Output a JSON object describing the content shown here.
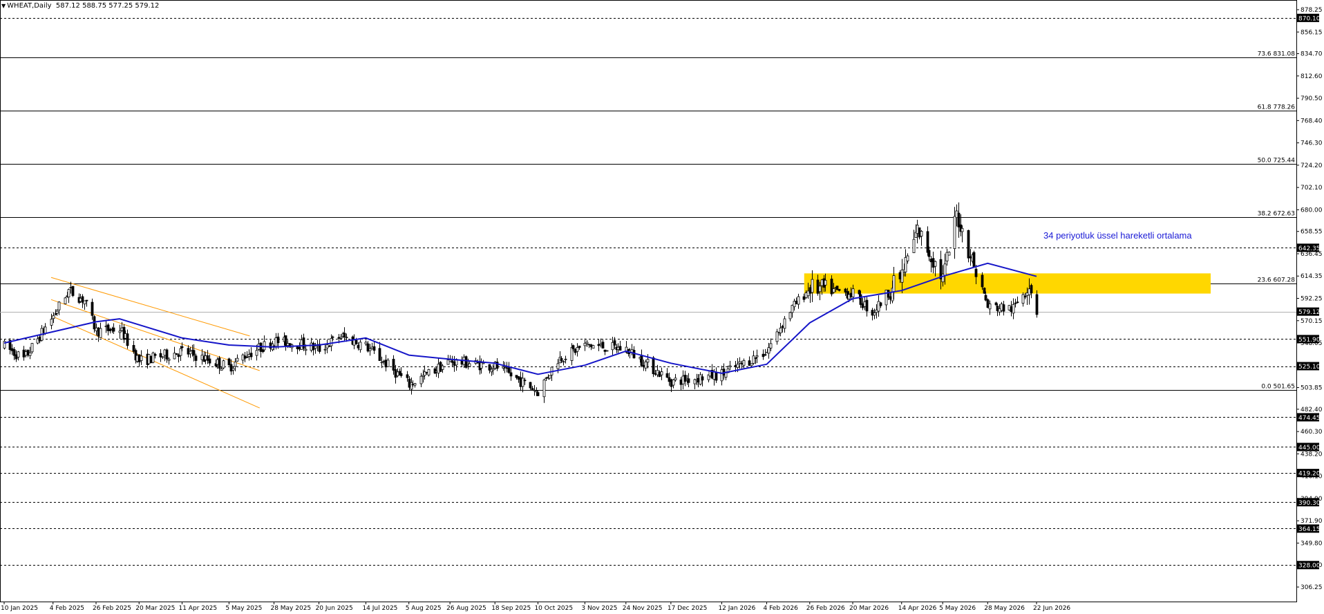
{
  "header": {
    "symbol": "WHEAT,Daily",
    "ohlc": "587.12 588.75 577.25 579.12"
  },
  "annotation": "34 periyotluk üssel hareketli ortalama",
  "colors": {
    "background": "#ffffff",
    "candle": "#000000",
    "ema": "#1515c8",
    "channel": "#ff9900",
    "zone": "#ffd700",
    "grid": "#000000",
    "label_bg": "#000000",
    "label_fg": "#ffffff",
    "gray_line": "#b0b0b0"
  },
  "icons": [
    "dropdown-triangle-icon"
  ],
  "price_axis": {
    "ticks": [
      "878.25",
      "856.15",
      "834.70",
      "812.60",
      "790.50",
      "768.40",
      "746.30",
      "724.20",
      "702.10",
      "680.00",
      "658.55",
      "636.45",
      "614.35",
      "592.25",
      "570.15",
      "548.05",
      "503.85",
      "482.40",
      "460.30",
      "438.20",
      "416.10",
      "394.00",
      "371.90",
      "349.80",
      "328.00",
      "306.25"
    ],
    "highlight_labels": [
      "870.10",
      "642.35",
      "579.12",
      "551.90",
      "525.10",
      "474.45",
      "445.00",
      "419.20",
      "390.30",
      "364.15",
      "328.00"
    ]
  },
  "date_axis": {
    "labels": [
      "10 Jan 2025",
      "4 Feb 2025",
      "26 Feb 2025",
      "20 Mar 2025",
      "11 Apr 2025",
      "5 May 2025",
      "28 May 2025",
      "20 Jun 2025",
      "14 Jul 2025",
      "5 Aug 2025",
      "26 Aug 2025",
      "18 Sep 2025",
      "10 Oct 2025",
      "3 Nov 2025",
      "24 Nov 2025",
      "17 Dec 2025",
      "12 Jan 2026",
      "4 Feb 2026",
      "26 Feb 2026",
      "20 Mar 2026",
      "14 Apr 2026",
      "5 May 2026",
      "28 May 2026",
      "22 Jun 2026"
    ]
  },
  "fibonacci": [
    {
      "label": "73.6 831.08",
      "price": 831.08
    },
    {
      "label": "61.8 778.26",
      "price": 778.26
    },
    {
      "label": "50.0 725.44",
      "price": 725.44
    },
    {
      "label": "38.2 672.63",
      "price": 672.63
    },
    {
      "label": "23.6 607.28",
      "price": 607.28
    },
    {
      "label": "0.0 501.65",
      "price": 501.65
    }
  ],
  "horizontal_levels": [
    870.1,
    642.35,
    551.9,
    525.1,
    474.45,
    445.0,
    419.2,
    390.3,
    364.15,
    328.0
  ],
  "current_price": 579.12,
  "zone": {
    "top": 617,
    "bottom": 597
  },
  "chart_data": {
    "type": "candlestick",
    "title": "WHEAT,Daily",
    "ylim": [
      306.25,
      878.25
    ],
    "xrange": [
      "10 Jan 2025",
      "22 Jun 2026"
    ],
    "anchors": [
      {
        "date": "10 Jan 2025",
        "price": 545
      },
      {
        "date": "20 Jan 2025",
        "price": 532
      },
      {
        "date": "4 Feb 2025",
        "price": 575
      },
      {
        "date": "12 Feb 2025",
        "price": 600
      },
      {
        "date": "20 Feb 2025",
        "price": 590
      },
      {
        "date": "26 Feb 2025",
        "price": 560
      },
      {
        "date": "10 Mar 2025",
        "price": 562
      },
      {
        "date": "20 Mar 2025",
        "price": 530
      },
      {
        "date": "11 Apr 2025",
        "price": 540
      },
      {
        "date": "5 May 2025",
        "price": 524
      },
      {
        "date": "12 May 2025",
        "price": 535
      },
      {
        "date": "28 May 2025",
        "price": 550
      },
      {
        "date": "10 Jun 2025",
        "price": 547
      },
      {
        "date": "20 Jun 2025",
        "price": 542
      },
      {
        "date": "1 Jul 2025",
        "price": 555
      },
      {
        "date": "14 Jul 2025",
        "price": 545
      },
      {
        "date": "5 Aug 2025",
        "price": 507
      },
      {
        "date": "26 Aug 2025",
        "price": 530
      },
      {
        "date": "18 Sep 2025",
        "price": 525
      },
      {
        "date": "10 Oct 2025",
        "price": 500
      },
      {
        "date": "20 Oct 2025",
        "price": 532
      },
      {
        "date": "3 Nov 2025",
        "price": 546
      },
      {
        "date": "24 Nov 2025",
        "price": 542
      },
      {
        "date": "17 Dec 2025",
        "price": 510
      },
      {
        "date": "12 Jan 2026",
        "price": 517
      },
      {
        "date": "4 Feb 2026",
        "price": 540
      },
      {
        "date": "15 Feb 2026",
        "price": 578
      },
      {
        "date": "26 Feb 2026",
        "price": 603
      },
      {
        "date": "20 Mar 2026",
        "price": 597
      },
      {
        "date": "30 Mar 2026",
        "price": 578
      },
      {
        "date": "14 Apr 2026",
        "price": 616
      },
      {
        "date": "22 Apr 2026",
        "price": 660
      },
      {
        "date": "5 May 2026",
        "price": 612
      },
      {
        "date": "12 May 2026",
        "price": 676
      },
      {
        "date": "20 May 2026",
        "price": 630
      },
      {
        "date": "28 May 2026",
        "price": 584
      },
      {
        "date": "10 Jun 2026",
        "price": 582
      },
      {
        "date": "18 Jun 2026",
        "price": 608
      },
      {
        "date": "22 Jun 2026",
        "price": 579
      }
    ],
    "ema": [
      {
        "date": "10 Jan 2025",
        "price": 548
      },
      {
        "date": "26 Feb 2025",
        "price": 569
      },
      {
        "date": "10 Mar 2025",
        "price": 572
      },
      {
        "date": "11 Apr 2025",
        "price": 553
      },
      {
        "date": "5 May 2025",
        "price": 546
      },
      {
        "date": "28 May 2025",
        "price": 544
      },
      {
        "date": "20 Jun 2025",
        "price": 546
      },
      {
        "date": "14 Jul 2025",
        "price": 553
      },
      {
        "date": "5 Aug 2025",
        "price": 536
      },
      {
        "date": "26 Aug 2025",
        "price": 532
      },
      {
        "date": "18 Sep 2025",
        "price": 528
      },
      {
        "date": "10 Oct 2025",
        "price": 517
      },
      {
        "date": "3 Nov 2025",
        "price": 526
      },
      {
        "date": "24 Nov 2025",
        "price": 540
      },
      {
        "date": "17 Dec 2025",
        "price": 528
      },
      {
        "date": "12 Jan 2026",
        "price": 518
      },
      {
        "date": "4 Feb 2026",
        "price": 527
      },
      {
        "date": "26 Feb 2026",
        "price": 568
      },
      {
        "date": "20 Mar 2026",
        "price": 592
      },
      {
        "date": "14 Apr 2026",
        "price": 600
      },
      {
        "date": "5 May 2026",
        "price": 614
      },
      {
        "date": "28 May 2026",
        "price": 627
      },
      {
        "date": "22 Jun 2026",
        "price": 614
      }
    ],
    "channel": {
      "upper": [
        {
          "date": "10 Jan 2025",
          "price": 613
        },
        {
          "date": "5 May 2025",
          "price": 555
        }
      ],
      "mid": [
        {
          "date": "10 Jan 2025",
          "price": 591
        },
        {
          "date": "5 May 2025",
          "price": 524
        }
      ],
      "lower": [
        {
          "date": "10 Jan 2025",
          "price": 575
        },
        {
          "date": "5 May 2025",
          "price": 488
        }
      ]
    }
  }
}
